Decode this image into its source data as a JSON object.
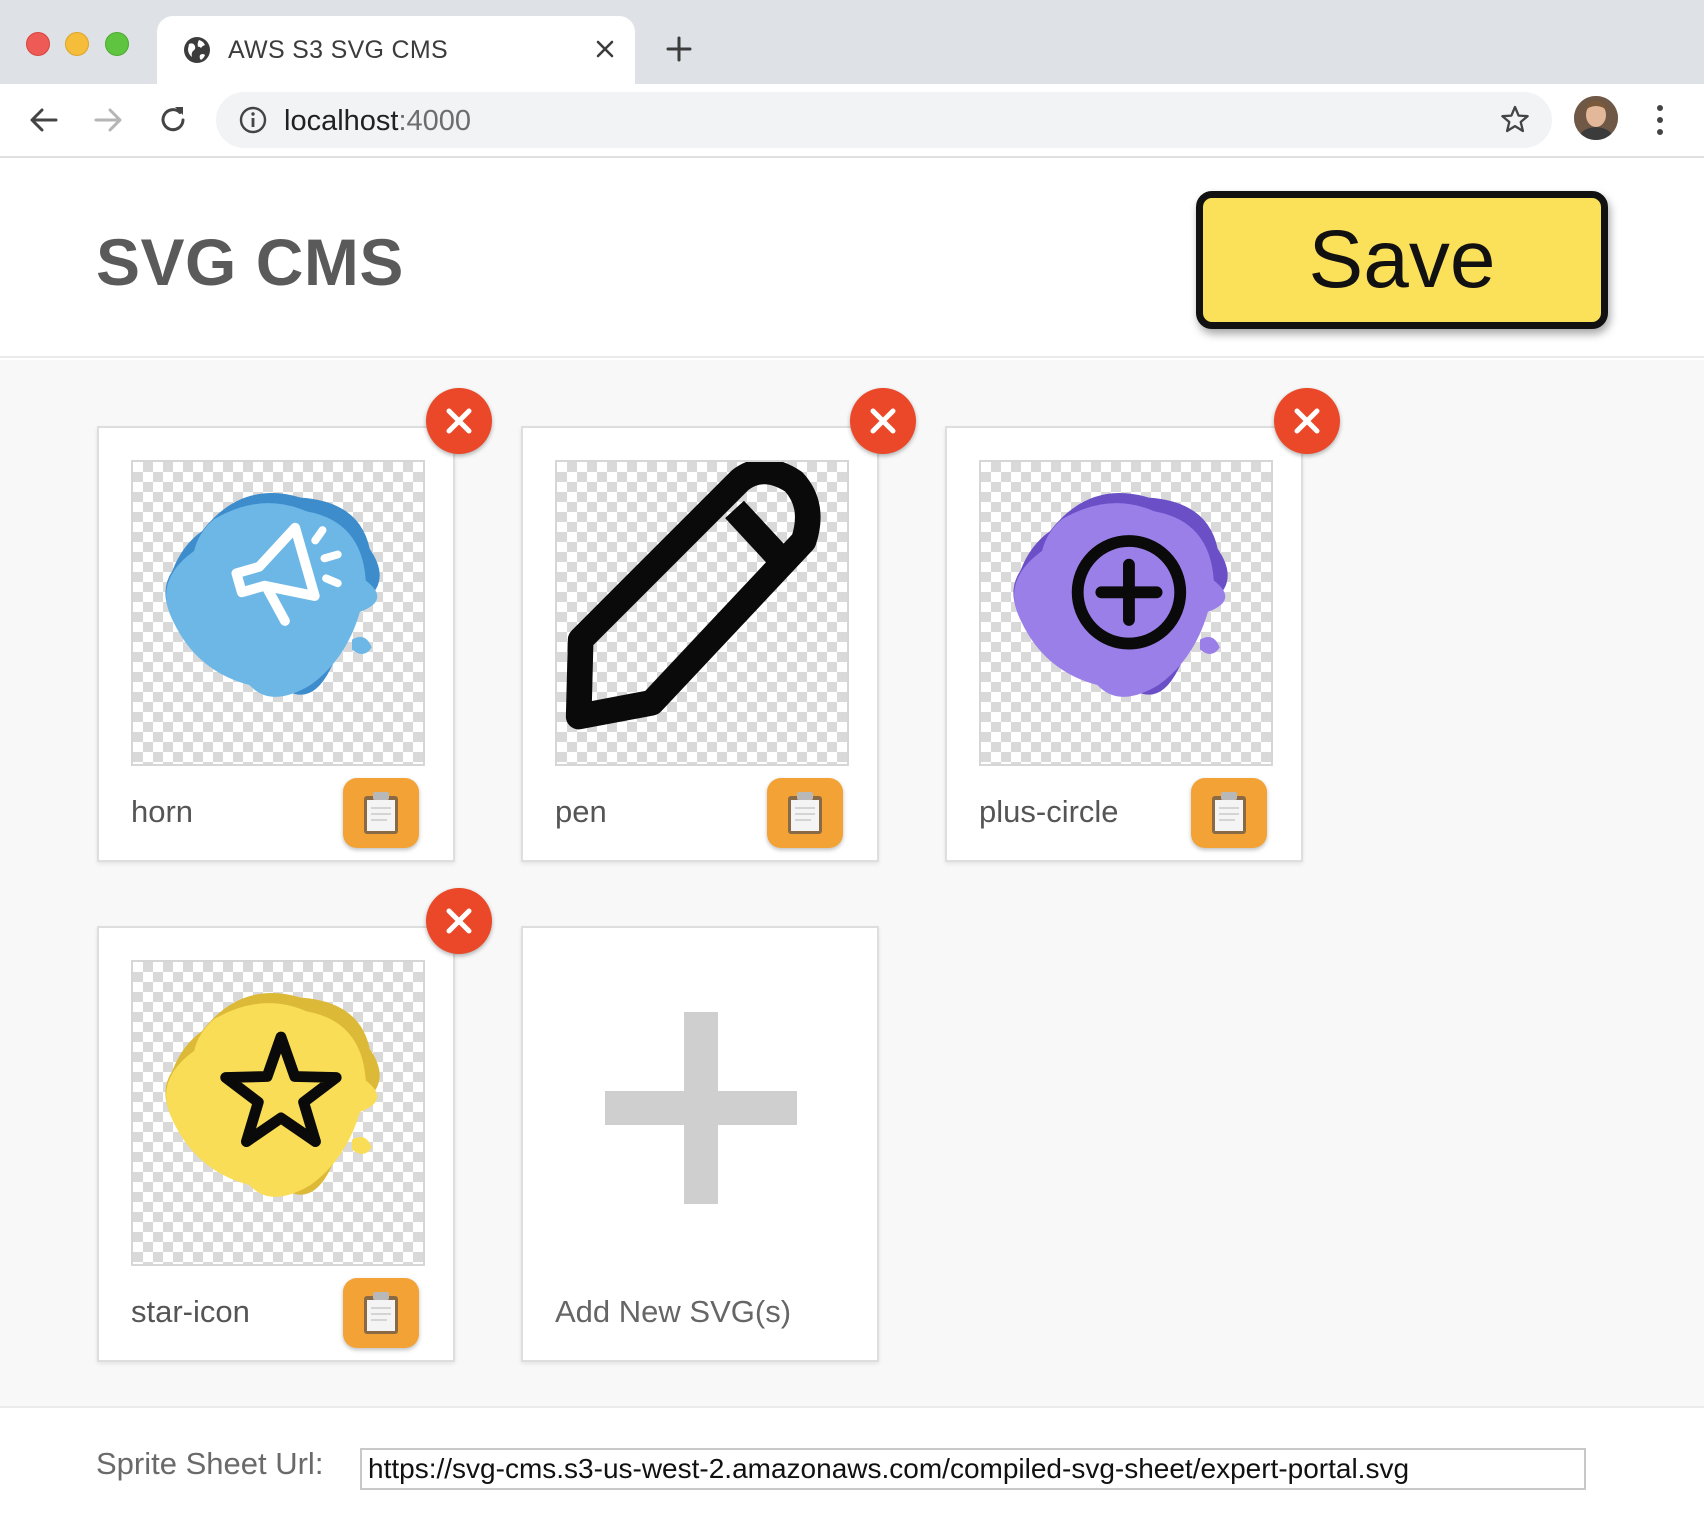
{
  "browser": {
    "tab_title": "AWS S3 SVG CMS",
    "url_host": "localhost",
    "url_port": ":4000"
  },
  "page": {
    "title": "SVG CMS",
    "save_label": "Save"
  },
  "cards": [
    {
      "name": "horn",
      "icon": "horn-icon",
      "blob_color": "#6db7e6",
      "blob_shadow": "#3d8ccc"
    },
    {
      "name": "pen",
      "icon": "pen-icon"
    },
    {
      "name": "plus-circle",
      "icon": "plus-circle-icon",
      "blob_color": "#9b7fe9",
      "blob_shadow": "#6b4fc7"
    },
    {
      "name": "star-icon",
      "icon": "star-icon",
      "blob_color": "#f9dd56",
      "blob_shadow": "#ddb938"
    }
  ],
  "add_card": {
    "label": "Add New SVG(s)"
  },
  "footer": {
    "sprite_label": "Sprite Sheet Url:",
    "sprite_url": "https://svg-cms.s3-us-west-2.amazonaws.com/compiled-svg-sheet/expert-portal.svg"
  },
  "colors": {
    "save_bg": "#fbe05a",
    "delete_bg": "#ea4828",
    "copy_bg": "#f3a235"
  }
}
